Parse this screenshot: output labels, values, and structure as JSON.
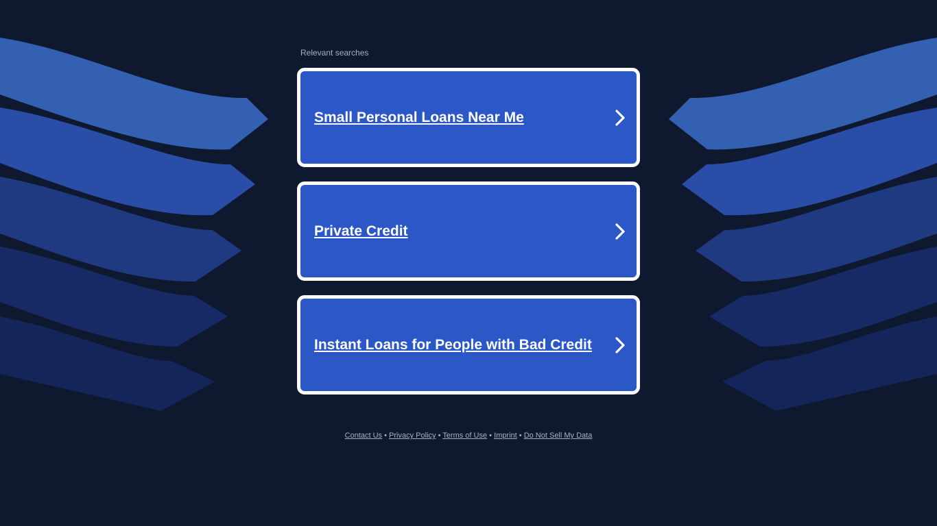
{
  "colors": {
    "background": "#0e1930",
    "card_fill": "#2b57c7",
    "card_border": "#ffffff",
    "text_muted": "#a9b0be"
  },
  "heading": "Relevant searches",
  "results": [
    {
      "label": "Small Personal Loans Near Me",
      "icon": "chevron-right-icon"
    },
    {
      "label": "Private Credit",
      "icon": "chevron-right-icon"
    },
    {
      "label": "Instant Loans for People with Bad Credit",
      "icon": "chevron-right-icon"
    }
  ],
  "footer": {
    "separator": "•",
    "links": [
      "Contact Us",
      "Privacy Policy",
      "Terms of Use",
      "Imprint",
      "Do Not Sell My Data"
    ]
  }
}
